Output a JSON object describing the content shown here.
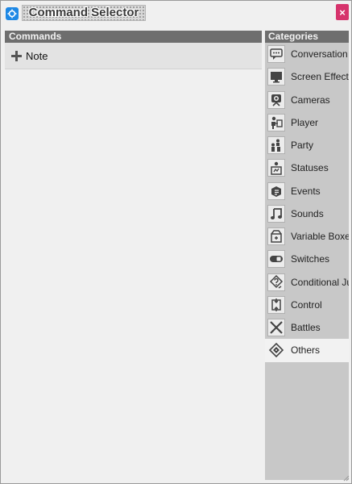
{
  "window": {
    "title": "Command Selector"
  },
  "commands": {
    "header": "Commands",
    "items": [
      {
        "label": "Note",
        "icon": "plus-icon"
      }
    ]
  },
  "categories": {
    "header": "Categories",
    "items": [
      {
        "label": "Conversation",
        "icon": "speech-bubble-icon"
      },
      {
        "label": "Screen Effects",
        "icon": "monitor-icon"
      },
      {
        "label": "Cameras",
        "icon": "camera-icon"
      },
      {
        "label": "Player",
        "icon": "player-icon"
      },
      {
        "label": "Party",
        "icon": "party-icon"
      },
      {
        "label": "Statuses",
        "icon": "statuses-icon"
      },
      {
        "label": "Events",
        "icon": "events-icon"
      },
      {
        "label": "Sounds",
        "icon": "music-note-icon"
      },
      {
        "label": "Variable Boxes",
        "icon": "variable-box-icon"
      },
      {
        "label": "Switches",
        "icon": "toggle-switch-icon"
      },
      {
        "label": "Conditional Jumps",
        "icon": "conditional-jump-icon"
      },
      {
        "label": "Control",
        "icon": "control-flow-icon"
      },
      {
        "label": "Battles",
        "icon": "crossed-swords-icon"
      },
      {
        "label": "Others",
        "icon": "others-diamond-icon"
      }
    ],
    "selected": "Others"
  },
  "colors": {
    "header_bg": "#6e6e6e",
    "close_button": "#d6336c",
    "app_icon": "#1e88e5",
    "selected_bg": "#f2f2f2"
  }
}
